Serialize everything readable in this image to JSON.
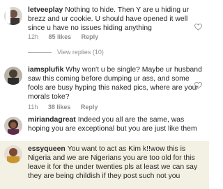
{
  "comments": [
    {
      "username": "letveeplay",
      "text": "Nothing to hide. Then Y are u hiding ur brezz and ur cookie. U should have opened it well since u have no issues hiding anything",
      "time": "12h",
      "likes": "85 likes",
      "reply": "Reply"
    },
    {
      "username": "iamsplufik",
      "text": "Why won't u be single? Maybe ur husband saw this coming before dumping ur ass, and some fools are busy hyping this naked pics, where are your morals toke?",
      "time": "11h",
      "likes": "38 likes",
      "reply": "Reply"
    },
    {
      "username": "miriandagreat",
      "text": "Indeed you all are the same, was hoping you are exceptional but you are just like them"
    },
    {
      "username": "essyqueen",
      "text": "You want to act as Kim k!!wow this is Nigeria and we are Nigerians you are too old for this leave it for the under twenties pls at least we can say they are being childish if they post such not you"
    }
  ],
  "view_replies": "View replies (10)",
  "icons": {
    "heart": "heart-outline-icon"
  },
  "colors": {
    "text": "#262626",
    "meta": "#8e8e8e",
    "highlight": "#f3f0e4"
  }
}
